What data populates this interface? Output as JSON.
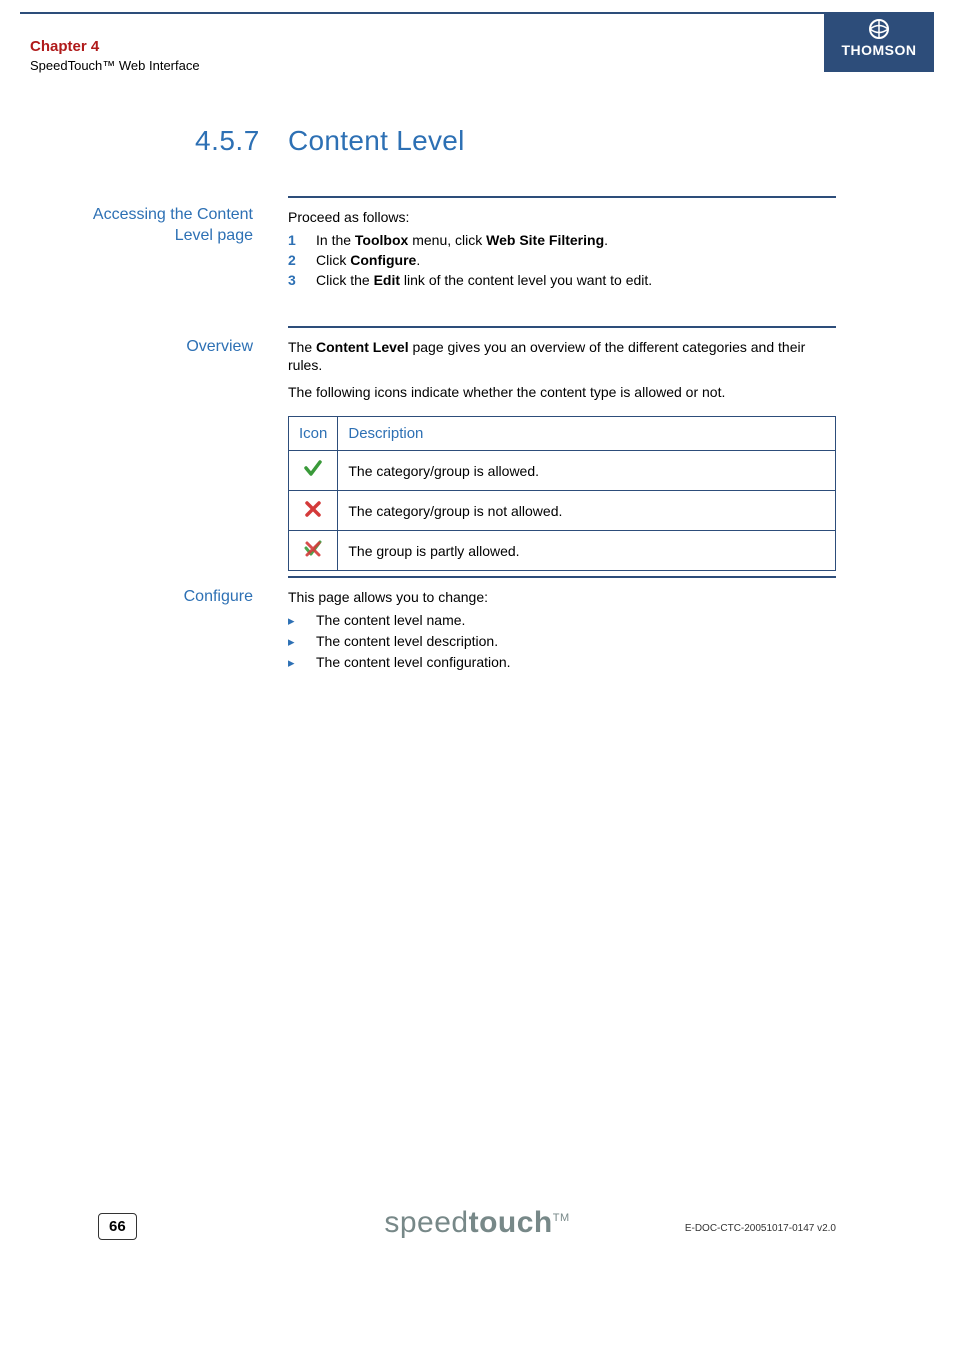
{
  "header": {
    "chapter": "Chapter 4",
    "subtitle": "SpeedTouch™ Web Interface",
    "brand": "THOMSON"
  },
  "heading": {
    "number": "4.5.7",
    "title": "Content Level"
  },
  "sections": {
    "access": {
      "margin_label": "Accessing the Content Level page",
      "intro": "Proceed as follows:",
      "steps": [
        {
          "n": "1",
          "pre": "In the ",
          "bold1": "Toolbox",
          "mid": " menu, click ",
          "bold2": "Web Site Filtering",
          "post": "."
        },
        {
          "n": "2",
          "pre": "Click ",
          "bold1": "Configure",
          "mid": "",
          "bold2": "",
          "post": "."
        },
        {
          "n": "3",
          "pre": "Click the ",
          "bold1": "Edit",
          "mid": " link of the content level you want to edit.",
          "bold2": "",
          "post": ""
        }
      ]
    },
    "overview": {
      "margin_label": "Overview",
      "p1_pre": "The ",
      "p1_bold": "Content Level",
      "p1_post": " page gives you an overview of the different categories and their rules.",
      "p2": "The following icons indicate whether the content type is allowed or not.",
      "table": {
        "head_icon": "Icon",
        "head_desc": "Description",
        "rows": [
          {
            "icon": "check",
            "desc": "The category/group is allowed."
          },
          {
            "icon": "cross",
            "desc": "The category/group is not allowed."
          },
          {
            "icon": "mixed",
            "desc": "The group is partly allowed."
          }
        ]
      }
    },
    "configure": {
      "margin_label": "Configure",
      "intro": "This page allows you to change:",
      "items": [
        "The content level name.",
        "The content level description.",
        "The content level configuration."
      ]
    }
  },
  "footer": {
    "page": "66",
    "logo_a": "speed",
    "logo_b": "touch",
    "logo_tm": "TM",
    "docid": "E-DOC-CTC-20051017-0147 v2.0"
  }
}
